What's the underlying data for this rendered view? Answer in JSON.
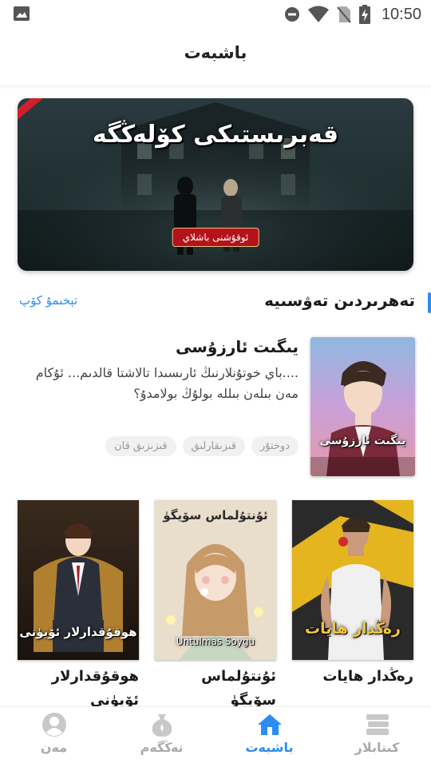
{
  "status_bar": {
    "time": "10:50",
    "icons": [
      "gallery-icon",
      "do-not-disturb-icon",
      "wifi-icon",
      "no-sim-icon",
      "battery-charging-icon"
    ]
  },
  "header": {
    "title": "باشبەت"
  },
  "banner": {
    "title": "قەبرىستىكى كۆلەڭگە",
    "badge": "ئوقۇشنى باشلاي"
  },
  "section": {
    "title": "تەھرىردىن تەۋسىيە",
    "more": "تېخىمۇ كۆپ"
  },
  "featured": {
    "title": "يىگىت ئارزۇسى",
    "description": "....باي خوتۇنلارنىڭ ئارىسىدا تالاشتا قالدىم... ئۇكام مەن بىلەن بىللە بولۇڭ بولامدۇ؟",
    "cover_text": "يىگىت ئارزۇسى",
    "tags": [
      "دوختۇر",
      "قىزىقارلىق",
      "قىزىزىق قان"
    ]
  },
  "books": [
    {
      "title": "رەڭدار ھايات",
      "cover_text": "رەڭدار ھايات"
    },
    {
      "title": "ئۇنتۇلماس سۆيگۈ",
      "cover_text": "ئۇنتۇلماس سۆيگۈ",
      "cover_caption": "Untulmas Soygu"
    },
    {
      "title": "ھوقۇقدارلار ئۆيۈنى",
      "cover_text": "ھوقۇقدارلار ئۆيۈنى"
    }
  ],
  "nav": {
    "items": [
      {
        "label": "كىتابلار",
        "icon": "books-icon",
        "active": false
      },
      {
        "label": "باشبەت",
        "icon": "home-icon",
        "active": true
      },
      {
        "label": "تەڭگەم",
        "icon": "coin-bag-icon",
        "active": false
      },
      {
        "label": "مەن",
        "icon": "user-icon",
        "active": false
      }
    ]
  },
  "colors": {
    "accent": "#2b8cf5",
    "nav_inactive": "#aaaaaa",
    "tag_bg": "#f1f1f1",
    "banner_badge": "#b5121b"
  }
}
